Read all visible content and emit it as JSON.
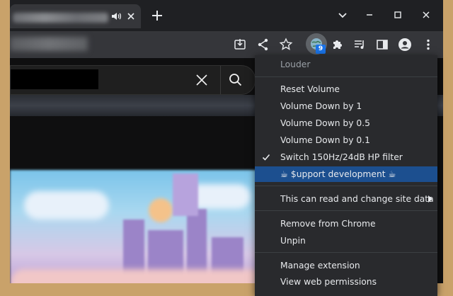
{
  "browser": {
    "tab": {
      "audio_icon": "speaker-icon",
      "close_icon": "close-icon"
    },
    "new_tab_icon": "plus-icon",
    "window_controls": [
      "chevron-down-icon",
      "minimize-icon",
      "maximize-icon",
      "close-icon"
    ],
    "toolbar_icons": [
      "install-app-icon",
      "share-icon",
      "star-icon",
      "globe-extension-icon",
      "puzzle-icon",
      "media-control-icon",
      "side-panel-icon",
      "profile-icon",
      "more-vert-icon"
    ],
    "extension_badge": "9"
  },
  "page": {
    "search_clear_icon": "close-icon",
    "search_button_icon": "search-icon"
  },
  "context_menu": {
    "title": "Louder",
    "items": [
      {
        "label": "Reset Volume"
      },
      {
        "label": "Volume Down by 1"
      },
      {
        "label": "Volume Down by 0.5"
      },
      {
        "label": "Volume Down by 0.1"
      },
      {
        "label": "Switch 150Hz/24dB HP filter",
        "checked": true
      },
      {
        "label": "☕ $upport development ☕",
        "highlighted": true
      }
    ],
    "site_access": "This can read and change site data",
    "remove": "Remove from Chrome",
    "unpin": "Unpin",
    "manage": "Manage extension",
    "permissions": "View web permissions"
  },
  "colors": {
    "menu_bg": "#292a2d",
    "highlight": "#1c4f8f",
    "badge": "#1a73e8",
    "frame": "#202124"
  }
}
